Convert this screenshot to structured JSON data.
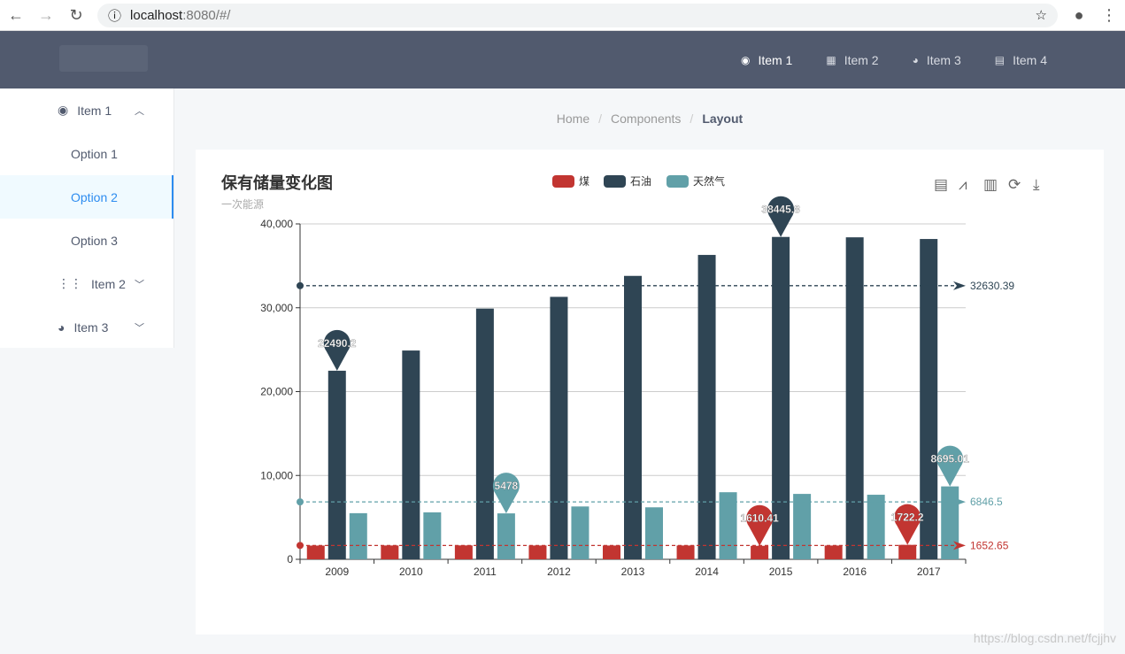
{
  "browser": {
    "url_host": "localhost",
    "url_rest": ":8080/#/"
  },
  "header": {
    "menu": [
      {
        "label": "Item 1",
        "icon": "navigation-icon",
        "active": true
      },
      {
        "label": "Item 2",
        "icon": "grid-icon"
      },
      {
        "label": "Item 3",
        "icon": "pie-icon"
      },
      {
        "label": "Item 4",
        "icon": "document-icon"
      }
    ]
  },
  "sidebar": {
    "item1": "Item 1",
    "options": [
      "Option 1",
      "Option 2",
      "Option 3"
    ],
    "active_option": 1,
    "item2": "Item 2",
    "item3": "Item 3"
  },
  "breadcrumb": [
    "Home",
    "Components",
    "Layout"
  ],
  "watermark": "https://blog.csdn.net/fcjjhv",
  "chart_data": {
    "type": "bar",
    "title": "保有储量变化图",
    "subtitle": "一次能源",
    "categories": [
      "2009",
      "2010",
      "2011",
      "2012",
      "2013",
      "2014",
      "2015",
      "2016",
      "2017"
    ],
    "ylim": [
      0,
      40000
    ],
    "yticks": [
      "0",
      "10,000",
      "20,000",
      "30,000",
      "40,000"
    ],
    "grid": true,
    "legend_position": "top-center",
    "toolbox": [
      "data-view-icon",
      "line-chart-icon",
      "bar-chart-icon",
      "restore-icon",
      "download-icon"
    ],
    "series": [
      {
        "name": "煤",
        "color": "#c23531",
        "values": [
          1640,
          1650,
          1660,
          1650,
          1645,
          1650,
          1610.41,
          1645,
          1722.2
        ],
        "markpoints": [
          {
            "index": 6,
            "label": "1610.41"
          },
          {
            "index": 8,
            "label": "1722.2"
          }
        ],
        "markline": {
          "value": 1652.65,
          "label": "1652.65"
        }
      },
      {
        "name": "石油",
        "color": "#2f4554",
        "values": [
          22490.2,
          24900,
          29900,
          31300,
          33800,
          36300,
          38445.8,
          38400,
          38200
        ],
        "markpoints": [
          {
            "index": 0,
            "label": "22490.2"
          },
          {
            "index": 6,
            "label": "38445.8"
          }
        ],
        "markline": {
          "value": 32630.39,
          "label": "32630.39"
        }
      },
      {
        "name": "天然气",
        "color": "#61a0a8",
        "values": [
          5500,
          5600,
          5478,
          6300,
          6200,
          8000,
          7800,
          7700,
          8695.01
        ],
        "markpoints": [
          {
            "index": 2,
            "label": "5478"
          },
          {
            "index": 8,
            "label": "8695.01"
          }
        ],
        "markline": {
          "value": 6846.5,
          "label": "6846.5"
        }
      }
    ]
  }
}
